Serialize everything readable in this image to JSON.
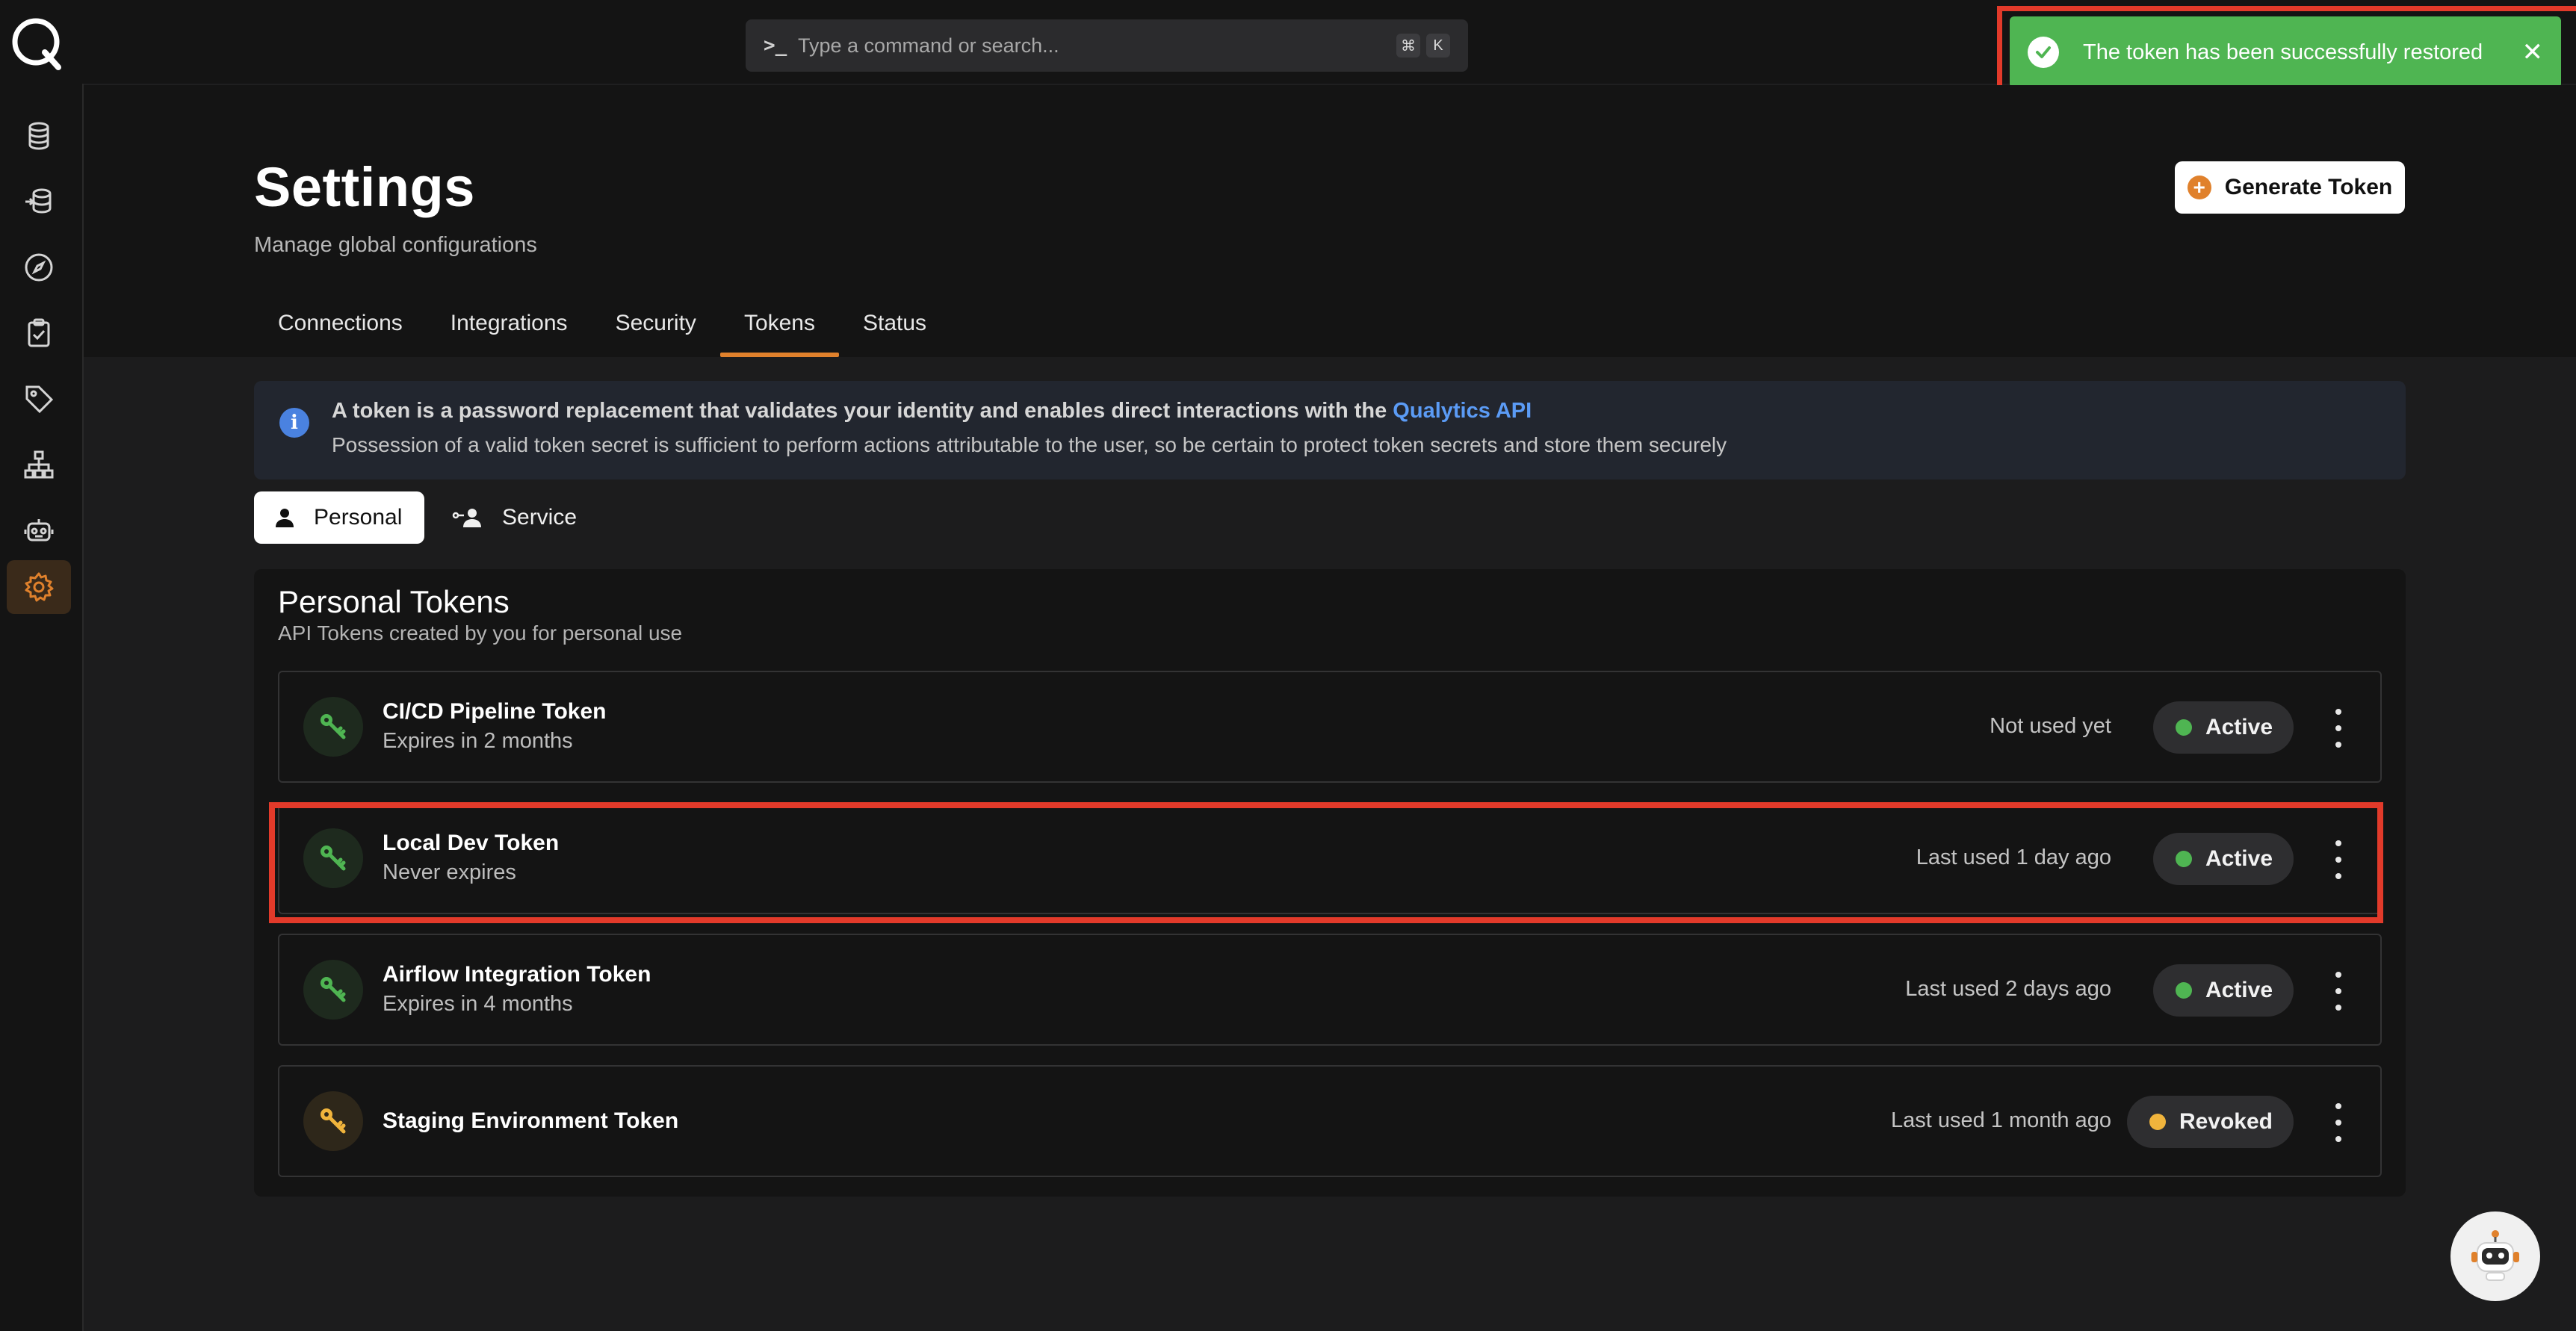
{
  "command_bar": {
    "placeholder": "Type a command or search...",
    "prompt_icon": ">_",
    "shortcut_keys": [
      "⌘",
      "K"
    ]
  },
  "toast": {
    "message": "The token has been successfully restored",
    "close_label": "✕",
    "color": "#4fb552"
  },
  "sidebar": {
    "items": [
      {
        "icon": "database-icon"
      },
      {
        "icon": "datastore-stack-icon"
      },
      {
        "icon": "compass-icon"
      },
      {
        "icon": "clipboard-check-icon"
      },
      {
        "icon": "tag-icon"
      },
      {
        "icon": "hierarchy-icon"
      },
      {
        "icon": "robot-icon"
      },
      {
        "icon": "gear-icon",
        "active": true
      }
    ]
  },
  "header": {
    "title": "Settings",
    "subtitle": "Manage global configurations",
    "generate_button": "Generate Token"
  },
  "tabs": [
    {
      "label": "Connections"
    },
    {
      "label": "Integrations"
    },
    {
      "label": "Security"
    },
    {
      "label": "Tokens",
      "active": true
    },
    {
      "label": "Status"
    }
  ],
  "info_banner": {
    "line1": "A token is a password replacement that validates your identity and enables direct interactions with the ",
    "link": "Qualytics API",
    "line2": "Possession of a valid token secret is sufficient to perform actions attributable to the user, so be certain to protect token secrets and store them securely"
  },
  "segments": {
    "personal": "Personal",
    "service": "Service"
  },
  "panel": {
    "title": "Personal Tokens",
    "subtitle": "API Tokens created by you for personal use"
  },
  "tokens": [
    {
      "name": "CI/CD Pipeline Token",
      "expiry": "Expires in 2 months",
      "usage": "Not used yet",
      "status": "Active",
      "status_color": "#4fb552",
      "key_color": "#4fb552"
    },
    {
      "name": "Local Dev Token",
      "expiry": "Never expires",
      "usage": "Last used 1 day ago",
      "status": "Active",
      "status_color": "#4fb552",
      "key_color": "#4fb552"
    },
    {
      "name": "Airflow Integration Token",
      "expiry": "Expires in 4 months",
      "usage": "Last used 2 days ago",
      "status": "Active",
      "status_color": "#4fb552",
      "key_color": "#4fb552"
    },
    {
      "name": "Staging Environment Token",
      "expiry": "",
      "usage": "Last used 1 month ago",
      "status": "Revoked",
      "status_color": "#f0b43c",
      "key_color": "#f0b43c"
    }
  ],
  "colors": {
    "accent": "#e0812c",
    "highlight": "#e23a2a",
    "link": "#5b9bf5"
  }
}
